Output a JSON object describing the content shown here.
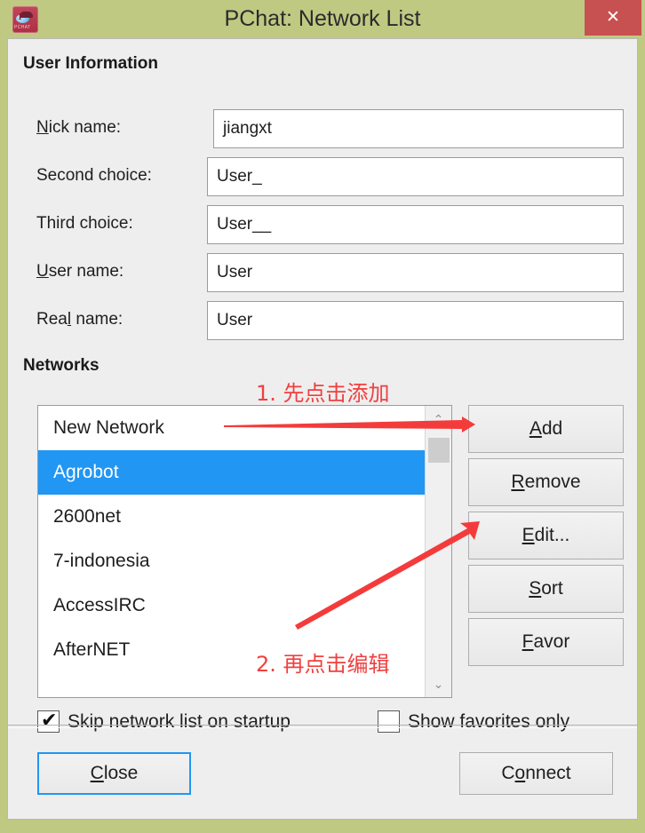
{
  "window": {
    "title": "PChat: Network List",
    "icon": "pchat-app-icon",
    "icon_word": "PCHAT",
    "close_label": "✕",
    "titlebar_color": "#bfc982",
    "close_button_color": "#c75050"
  },
  "user_information": {
    "group_label": "User Information",
    "fields": [
      {
        "label_pre": "",
        "label_acc": "N",
        "label_post": "ick name:",
        "value": "jiangxt"
      },
      {
        "label_pre": "Second choice:",
        "label_acc": "",
        "label_post": "",
        "value": "User_"
      },
      {
        "label_pre": "Third choice:",
        "label_acc": "",
        "label_post": "",
        "value": "User__"
      },
      {
        "label_pre": "",
        "label_acc": "U",
        "label_post": "ser name:",
        "value": "User"
      },
      {
        "label_pre": "Rea",
        "label_acc": "l",
        "label_post": " name:",
        "value": "User"
      }
    ]
  },
  "networks": {
    "group_label": "Networks",
    "items": [
      {
        "name": "New Network",
        "selected": false
      },
      {
        "name": "Agrobot",
        "selected": true
      },
      {
        "name": "2600net",
        "selected": false
      },
      {
        "name": "7-indonesia",
        "selected": false
      },
      {
        "name": "AccessIRC",
        "selected": false
      },
      {
        "name": "AfterNET",
        "selected": false
      }
    ],
    "selection_color": "#2196f3",
    "scrollbar": {
      "up": "⌃",
      "down": "⌄"
    },
    "buttons": [
      {
        "pre": "",
        "acc": "A",
        "post": "dd"
      },
      {
        "pre": "",
        "acc": "R",
        "post": "emove"
      },
      {
        "pre": "",
        "acc": "E",
        "post": "dit..."
      },
      {
        "pre": "",
        "acc": "S",
        "post": "ort"
      },
      {
        "pre": "",
        "acc": "F",
        "post": "avor"
      }
    ]
  },
  "options": {
    "skip_list": {
      "label": "Skip network list on startup",
      "checked": true,
      "tick": "✔"
    },
    "show_favorites": {
      "label": "Show favorites only",
      "checked": false,
      "tick": ""
    }
  },
  "footer": {
    "close": {
      "pre": "",
      "acc": "C",
      "post": "lose"
    },
    "connect": {
      "pre": "C",
      "acc": "o",
      "post": "nnect"
    }
  },
  "annotations": [
    {
      "text": "1. 先点击添加",
      "color": "#f04040"
    },
    {
      "text": "2. 再点击编辑",
      "color": "#f04040"
    }
  ]
}
